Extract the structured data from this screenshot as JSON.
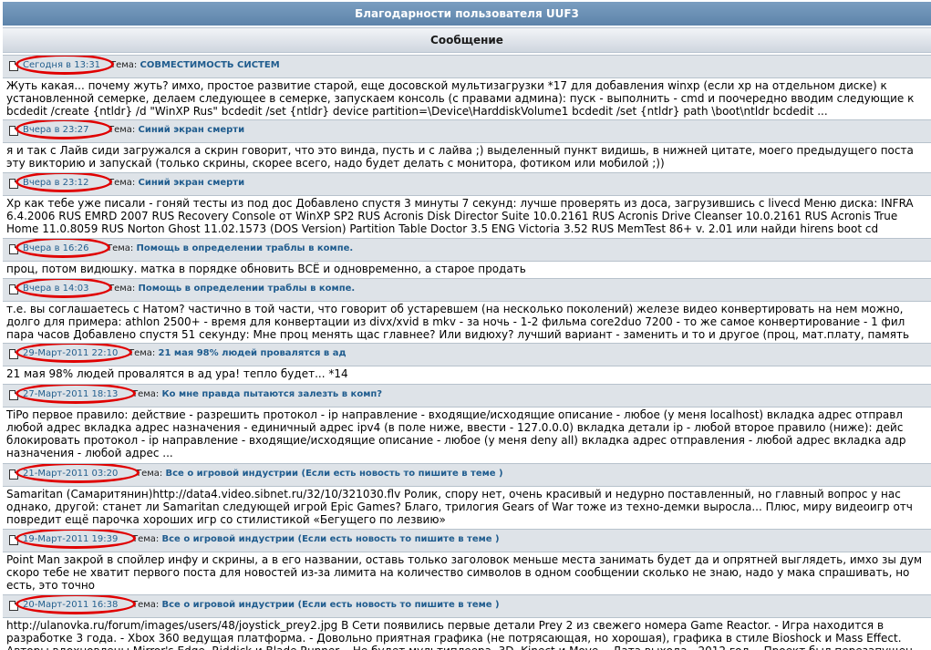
{
  "header": {
    "title": "Благодарности пользователя UUF3",
    "column": "Сообщение"
  },
  "topic_prefix": "Тема:",
  "posts": [
    {
      "date": "Сегодня в 13:31",
      "topic": "СОВМЕСТИМОСТЬ СИСТЕМ",
      "lines": [
        "Жуть какая... почему жуть? имхо, простое развитие старой, еще досовской мультизагрузки *17 для добавления winxp (если xp на отдельном диске) к",
        "установленной семерке, делаем следующее в семерке, запускаем консоль (с правами админа): пуск - выполнить - cmd и поочередно вводим следующие к",
        "bcdedit /create {ntldr} /d \"WinXP Rus\" bcdedit /set {ntldr} device partition=\\Device\\HarddiskVolume1 bcdedit /set {ntldr} path \\boot\\ntldr bcdedit ..."
      ]
    },
    {
      "date": "Вчера в 23:27",
      "topic": "Синий экран смерти",
      "lines": [
        "я и так с Лайв сиди загружался а скрин говорит, что это винда, пусть и с лайва ;) выделенный пункт видишь, в нижней цитате, моего предыдущего поста",
        "эту викторию и запускай (только скрины, скорее всего, надо будет делать с монитора, фотиком или мобилой ;))"
      ]
    },
    {
      "date": "Вчера в 23:12",
      "topic": "Синий экран смерти",
      "lines": [
        "Хр как тебе уже писали - гоняй тесты из под дос Добавлено спустя 3 минуты 7 секунд: лучше проверять из доса, загрузившись с livecd Меню диска: INFRA",
        "6.4.2006 RUS EMRD 2007 RUS Recovery Console от WinXP SP2 RUS Acronis Disk Director Suite 10.0.2161 RUS Acronis Drive Cleanser 10.0.2161 RUS Acronis True",
        "Home 11.0.8059 RUS Norton Ghost 11.02.1573 (DOS Version) Partition Table Doctor 3.5 ENG Victoria 3.52 RUS MemTest 86+ v. 2.01 или найди hirens boot cd"
      ]
    },
    {
      "date": "Вчера в 16:26",
      "topic": "Помощь в определении траблы в компе.",
      "lines": [
        "проц, потом видюшку. матка в порядке обновить ВСЁ и одновременно, а старое продать"
      ]
    },
    {
      "date": "Вчера в 14:03",
      "topic": "Помощь в определении траблы в компе.",
      "lines": [
        "т.е. вы соглашаетесь с Натом? частично в той части, что говорит об устаревшем (на несколько поколений) железе видео конвертировать на нем можно,",
        "долго для примера: athlon 2500+ - время для конвертации из divx/xvid в mkv - за ночь - 1-2 фильма core2duo 7200 - то же самое конвертирование - 1 фил",
        "пара часов Добавлено спустя 51 секунду: Мне проц менять щас главнее? Или видюху? лучший вариант - заменить и то и другое (проц, мат.плату, память"
      ]
    },
    {
      "date": "29-Март-2011 22:10",
      "topic": "21 мая 98% людей провалятся в ад",
      "lines": [
        "21 мая 98% людей провалятся в ад ура! тепло будет... *14"
      ]
    },
    {
      "date": "27-Март-2011 18:13",
      "topic": "Ко мне правда пытаются залезть в комп?",
      "lines": [
        "TiPo первое правило: действие - разрешить протокол - ip направление - входящие/исходящие описание - любое (у меня localhost) вкладка адрес отправл",
        "любой адрес вкладка адрес назначения - единичный адрес ipv4 (в поле ниже, ввести - 127.0.0.0) вкладка детали ip - любой второе правило (ниже): дейс",
        "блокировать протокол - ip направление - входящие/исходящие описание - любое (у меня deny all) вкладка адрес отправления - любой адрес вкладка адр",
        "назначения - любой адрес ..."
      ]
    },
    {
      "date": "21-Март-2011 03:20",
      "topic": "Все о игровой индустрии (Если есть новость то пишите в теме )",
      "lines": [
        "Samaritan (Самаритянин)http://data4.video.sibnet.ru/32/10/321030.flv Ролик, спору нет, очень красивый и недурно поставленный, но главный вопрос у нас",
        "однако, другой: станет ли Samaritan следующей игрой Epic Games? Благо, трилогия Gears of War тоже из техно-демки выросла... Плюс, миру видеоигр отч",
        "повредит ещё парочка хороших игр со стилистикой «Бегущего по лезвию»"
      ]
    },
    {
      "date": "19-Март-2011 19:39",
      "topic": "Все о игровой индустрии (Если есть новость то пишите в теме )",
      "lines": [
        "Point Man закрой в спойлер инфу и скрины, а в его названии, оставь только заголовок меньше места занимать будет да и опрятней выглядеть, имхо зы дум",
        "скоро тебе не хватит первого поста для новостей из-за лимита на количество символов в одном сообщении сколько не знаю, надо у мака спрашивать, но",
        "есть, это точно"
      ]
    },
    {
      "date": "20-Март-2011 16:38",
      "topic": "Все о игровой индустрии (Если есть новость то пишите в теме )",
      "lines": [
        "http://ulanovka.ru/forum/images/users/48/joystick_prey2.jpg В Сети появились первые детали Prey 2 из свежего номера Game Reactor. - Игра находится в",
        "разработке 3 года. - Xbox 360 ведущая платформа. - Довольно приятная графика (не потрясающая, но хорошая), графика в стиле Bioshock и Mass Effect.",
        "Авторы вдохновлены Mirror's Edge, Riddick и Blade Runner. - Не будет мультиплеера, 3D, Kinect и Move. - Дата выхода - 2012 год. - Проект был перезапущен"
      ]
    }
  ],
  "colors": {
    "title_bar": "#5d84aa",
    "post_bar": "#dee3e8",
    "link": "#1f5c8e",
    "highlight_ring": "#e00000"
  }
}
